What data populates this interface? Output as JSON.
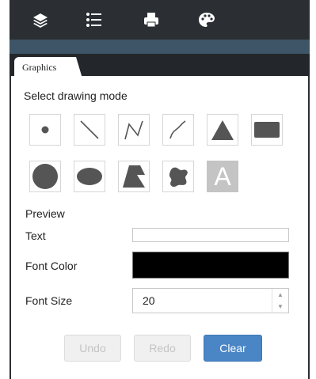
{
  "toolbar": {
    "icons": [
      "layers-icon",
      "list-icon",
      "print-icon",
      "palette-icon"
    ]
  },
  "tab": {
    "label": "Graphics"
  },
  "drawing": {
    "heading": "Select drawing mode",
    "modes": [
      "point",
      "line",
      "polyline",
      "freehand-line",
      "triangle",
      "rectangle",
      "circle",
      "ellipse",
      "polygon",
      "freehand-polygon",
      "text"
    ],
    "selected": "text",
    "text_glyph": "A"
  },
  "preview": {
    "heading": "Preview",
    "text_label": "Text",
    "text_value": "",
    "font_color_label": "Font Color",
    "font_color_value": "#000000",
    "font_size_label": "Font Size",
    "font_size_value": "20"
  },
  "buttons": {
    "undo": "Undo",
    "redo": "Redo",
    "clear": "Clear"
  },
  "colors": {
    "toolbar_bg": "#2b2f33",
    "accent": "#4a86c5",
    "shape_fill": "#555555"
  }
}
